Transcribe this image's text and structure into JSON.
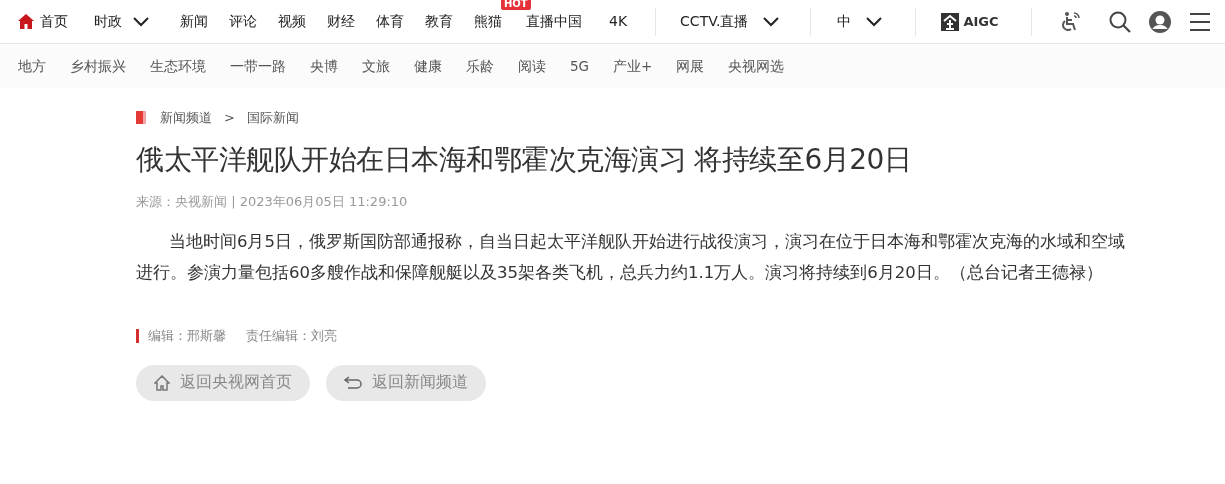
{
  "top_nav": {
    "items": [
      {
        "label": "首页",
        "kind": "home"
      },
      {
        "label": "时政",
        "kind": "dropdown"
      },
      {
        "label": "新闻",
        "kind": "link"
      },
      {
        "label": "评论",
        "kind": "link"
      },
      {
        "label": "视频",
        "kind": "link"
      },
      {
        "label": "财经",
        "kind": "link"
      },
      {
        "label": "体育",
        "kind": "link"
      },
      {
        "label": "教育",
        "kind": "link"
      },
      {
        "label": "熊猫",
        "kind": "link",
        "badge": "HOT"
      },
      {
        "label": "直播中国",
        "kind": "link"
      },
      {
        "label": "4K",
        "kind": "link"
      }
    ],
    "live_menu": "CCTV.直播",
    "language_menu": "中",
    "logo_text": "AIGC"
  },
  "sub_nav": [
    "地方",
    "乡村振兴",
    "生态环境",
    "一带一路",
    "央博",
    "文旅",
    "健康",
    "乐龄",
    "阅读",
    "5G",
    "产业+",
    "网展",
    "央视网选"
  ],
  "breadcrumb": [
    "新闻频道",
    "国际新闻"
  ],
  "breadcrumb_separator": ">",
  "article": {
    "title": "俄太平洋舰队开始在日本海和鄂霍次克海演习 将持续至6月20日",
    "meta": "来源：央视新闻 | 2023年06月05日 11:29:10",
    "body": "当地时间6月5日，俄罗斯国防部通报称，自当日起太平洋舰队开始进行战役演习，演习在位于日本海和鄂霍次克海的水域和空域进行。参演力量包括60多艘作战和保障舰艇以及35架各类飞机，总兵力约1.1万人。演习将持续到6月20日。（总台记者王德禄）",
    "editor": "编辑：邢斯馨",
    "chief_editor": "责任编辑：刘亮"
  },
  "buttons": [
    {
      "label": "返回央视网首页",
      "kind": "home"
    },
    {
      "label": "返回新闻频道",
      "kind": "back"
    }
  ]
}
